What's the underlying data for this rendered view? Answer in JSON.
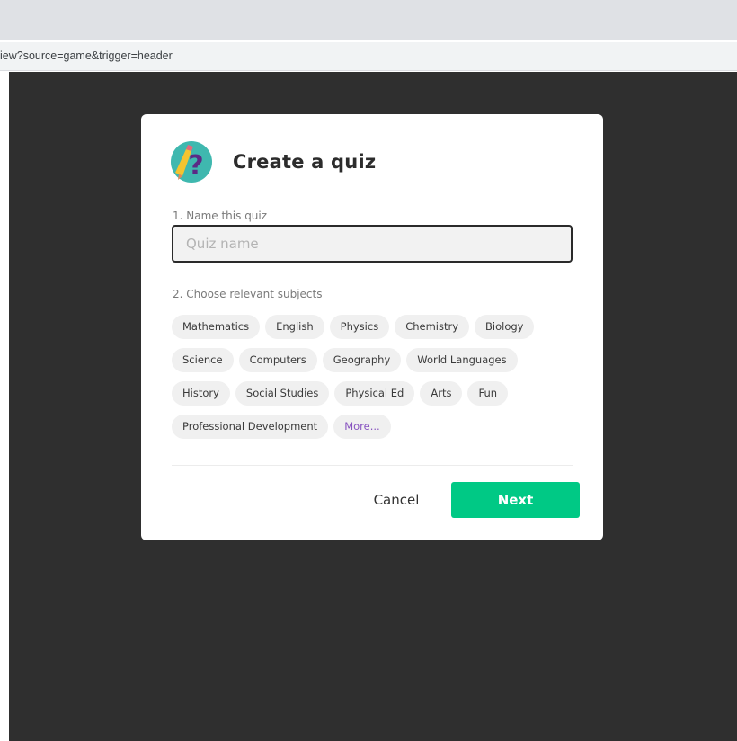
{
  "browser": {
    "url_fragment": "iew?source=game&trigger=header"
  },
  "modal": {
    "title": "Create a quiz",
    "logo_icon": "quiz-question-pencil-icon",
    "step1_label": "1. Name this quiz",
    "quiz_name_value": "",
    "quiz_name_placeholder": "Quiz name",
    "step2_label": "2. Choose relevant subjects",
    "subjects": [
      [
        "Mathematics",
        "English",
        "Physics",
        "Chemistry",
        "Biology"
      ],
      [
        "Science",
        "Computers",
        "Geography",
        "World Languages"
      ],
      [
        "History",
        "Social Studies",
        "Physical Ed",
        "Arts",
        "Fun"
      ],
      [
        "Professional Development"
      ]
    ],
    "more_label": "More...",
    "cancel_label": "Cancel",
    "next_label": "Next"
  },
  "colors": {
    "accent_green": "#00c985",
    "more_link": "#8854c0",
    "overlay": "#2f2f2f",
    "logo_teal": "#3fb8af",
    "logo_purple": "#5b2a86"
  }
}
